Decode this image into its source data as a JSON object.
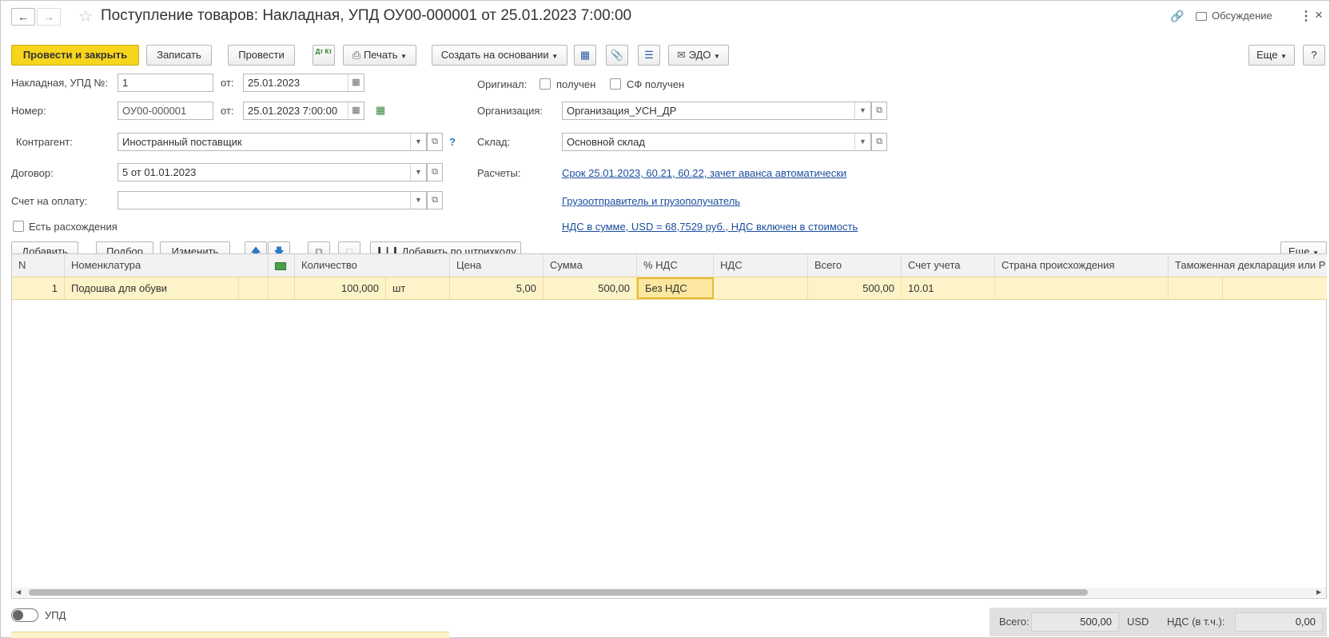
{
  "header": {
    "title": "Поступление товаров: Накладная, УПД ОУ00-000001 от 25.01.2023 7:00:00",
    "discussion_label": "Обсуждение"
  },
  "toolbar": {
    "post_close": "Провести и закрыть",
    "save": "Записать",
    "post": "Провести",
    "dt_kt": "Дт Кт",
    "print": "Печать",
    "create_based": "Создать на основании",
    "edo": "ЭДО",
    "more": "Еще",
    "help": "?"
  },
  "form": {
    "invoice_label": "Накладная, УПД №:",
    "invoice_value": "1",
    "from_label": "от:",
    "invoice_date": "25.01.2023",
    "number_label": "Номер:",
    "number_value": "ОУ00-000001",
    "number_date": "25.01.2023  7:00:00",
    "counterparty_label": "Контрагент:",
    "counterparty_value": "Иностранный поставщик",
    "question": "?",
    "contract_label": "Договор:",
    "contract_value": "5 от 01.01.2023",
    "payment_label": "Счет на оплату:",
    "payment_value": "",
    "discrepancy_label": "Есть расхождения",
    "original_label": "Оригинал:",
    "received_label": "получен",
    "sf_received_label": "СФ получен",
    "org_label": "Организация:",
    "org_value": "Организация_УСН_ДР",
    "warehouse_label": "Склад:",
    "warehouse_value": "Основной склад",
    "settlements_label": "Расчеты:",
    "settlements_link": "Срок 25.01.2023, 60.21, 60.22, зачет аванса автоматически",
    "shipper_link": "Грузоотправитель и грузополучатель",
    "vat_link": "НДС в сумме, USD = 68,7529 руб., НДС включен в стоимость"
  },
  "table_toolbar": {
    "add": "Добавить",
    "pick": "Подбор",
    "change": "Изменить",
    "add_barcode": "Добавить по штрихкоду",
    "more": "Еще"
  },
  "table": {
    "columns": [
      "N",
      "Номенклатура",
      "Количество",
      "Цена",
      "Сумма",
      "% НДС",
      "НДС",
      "Всего",
      "Счет учета",
      "Страна происхождения",
      "Таможенная декларация или Р"
    ],
    "rows": [
      {
        "n": "1",
        "item": "Подошва для обуви",
        "qty": "100,000",
        "unit": "шт",
        "price": "5,00",
        "sum": "500,00",
        "vat_rate": "Без НДС",
        "vat": "",
        "total": "500,00",
        "account": "10.01",
        "country": "",
        "customs": ""
      }
    ]
  },
  "footer": {
    "upd_label": "УПД",
    "total_label": "Всего:",
    "total_value": "500,00",
    "currency": "USD",
    "vat_label": "НДС (в т.ч.):",
    "vat_value": "0,00"
  },
  "colors": {
    "accent": "#f7d51d",
    "row_highlight": "#fdf3c8",
    "link": "#1c4e9e"
  }
}
